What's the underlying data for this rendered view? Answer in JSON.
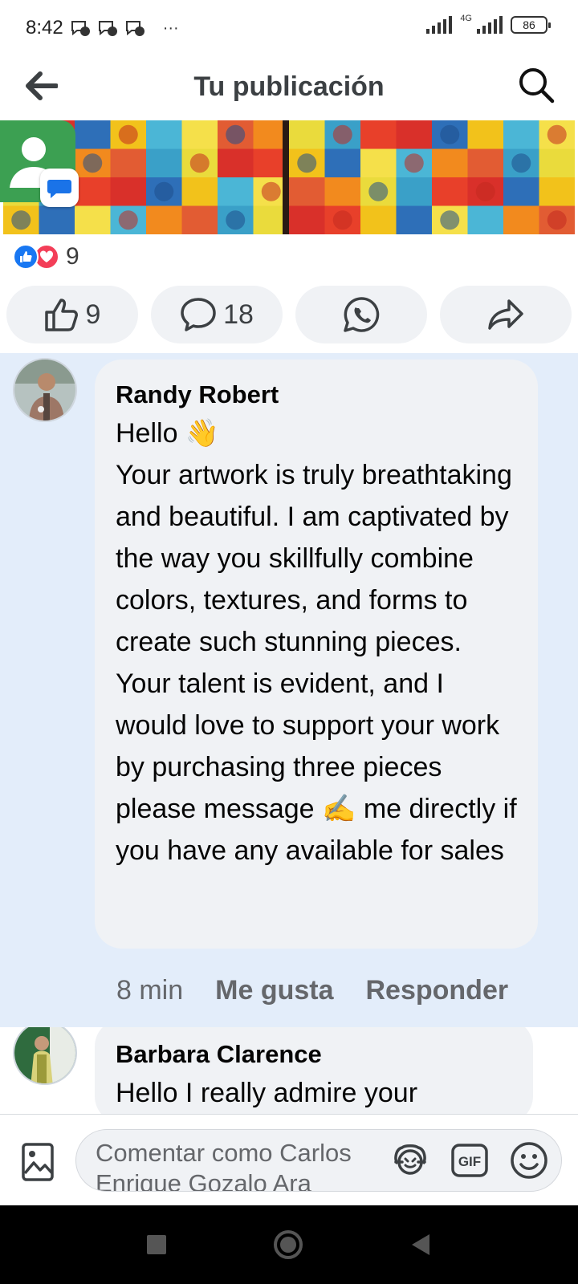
{
  "status_bar": {
    "time": "8:42",
    "notifications": [
      "chat-notification-icon",
      "chat-notification-icon",
      "chat-notification-icon"
    ],
    "more": "···",
    "network_label": "4G",
    "battery": "86"
  },
  "header": {
    "title": "Tu publicación"
  },
  "reactions": {
    "count": "9"
  },
  "actions": {
    "like_count": "9",
    "comment_count": "18"
  },
  "comments": [
    {
      "author": "Randy Robert",
      "text": "Hello 👋\nYour artwork is truly breathtaking and beautiful. I am captivated by the way you skillfully combine colors, textures, and forms to create such stunning pieces. Your talent is evident, and I would love to support your work by purchasing three pieces please message ✍️ me directly if you have any available for sales",
      "time": "8 min",
      "like_label": "Me gusta",
      "reply_label": "Responder"
    },
    {
      "author": "Barbara Clarence",
      "text": "Hello I really admire your"
    }
  ],
  "composer": {
    "placeholder": "Comentar como Carlos Enrique Gozalo Ara",
    "gif_label": "GIF"
  },
  "colors": {
    "fb_blue": "#1877f2",
    "love_red": "#f33e58",
    "highlight_bg": "#e3edfa",
    "bubble_bg": "#f0f2f5"
  }
}
